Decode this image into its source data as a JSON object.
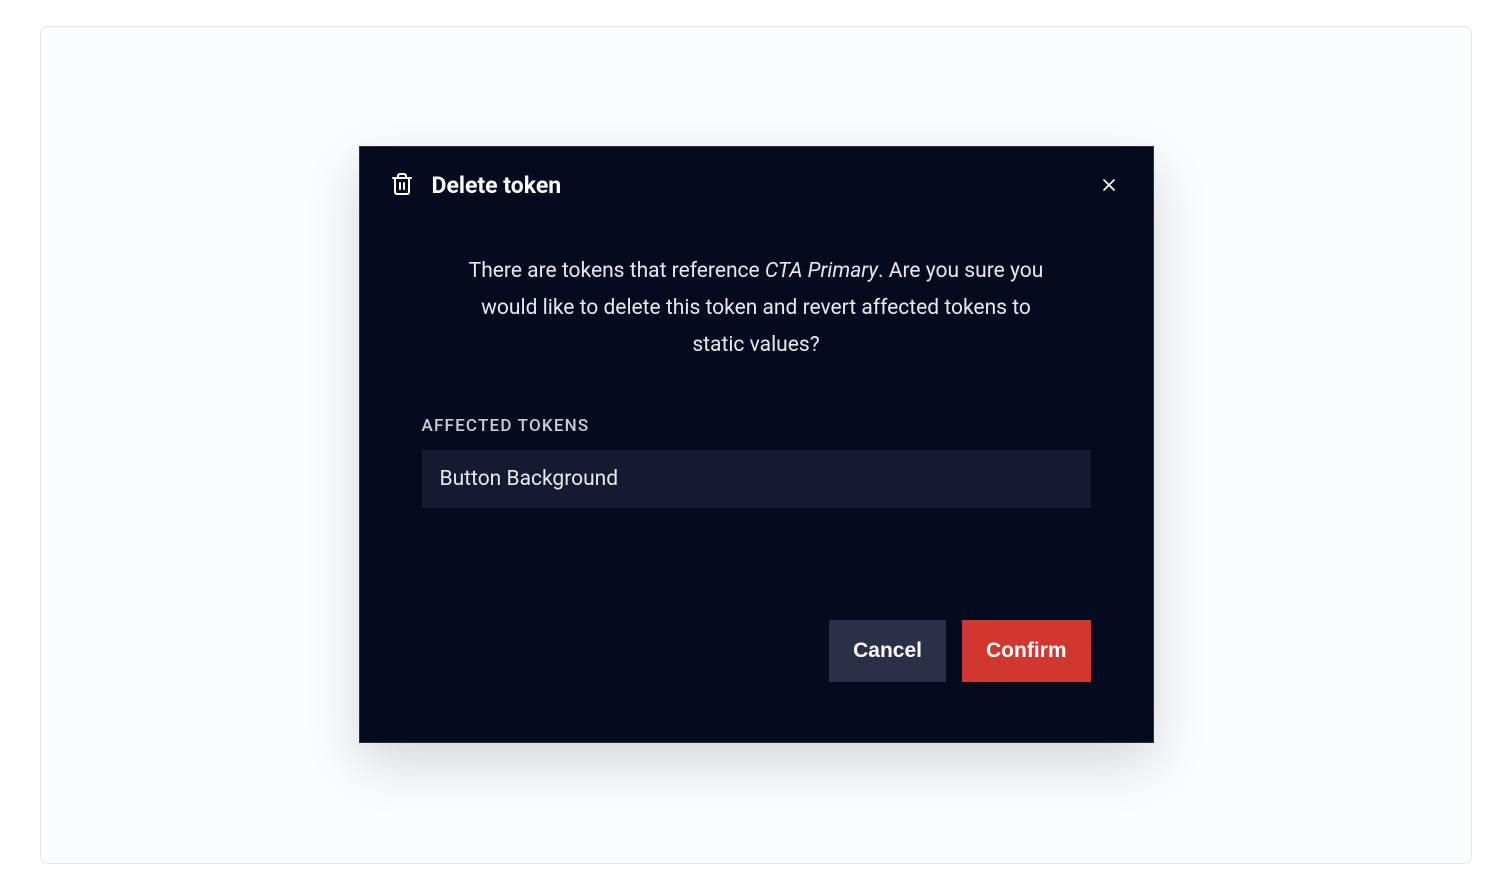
{
  "modal": {
    "title": "Delete token",
    "description_prefix": "There are tokens that reference ",
    "description_token_name": "CTA Primary",
    "description_suffix": ". Are you sure you would like to delete this token and revert affected tokens to static values?",
    "section_label": "Affected Tokens",
    "affected_tokens": [
      "Button Background"
    ],
    "cancel_label": "Cancel",
    "confirm_label": "Confirm"
  },
  "colors": {
    "modal_bg": "#040B1F",
    "item_bg": "#141b30",
    "secondary_btn": "#2b3048",
    "primary_btn": "#d0372e"
  }
}
